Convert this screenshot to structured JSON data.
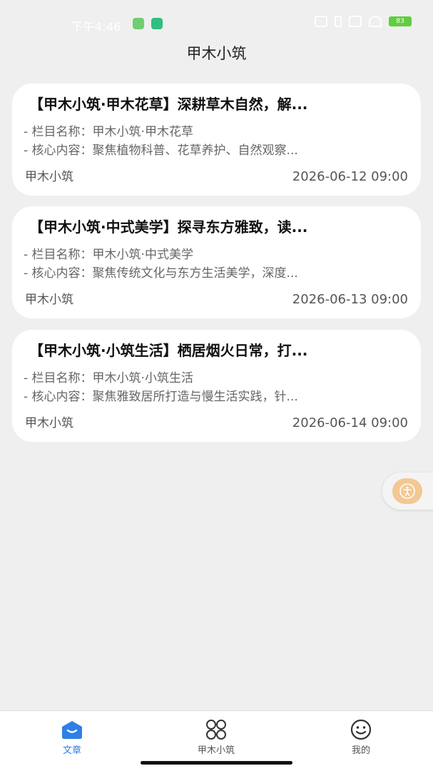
{
  "status_bar": {
    "time": "下午4:46",
    "battery": "83"
  },
  "header": {
    "title": "甲木小筑"
  },
  "articles": [
    {
      "title": "【甲木小筑·甲木花草】深耕草木自然，解...",
      "line1": "- 栏目名称：甲木小筑·甲木花草",
      "line2": "- 核心内容：聚焦植物科普、花草养护、自然观察...",
      "source": "甲木小筑",
      "date": "2026-06-12 09:00"
    },
    {
      "title": "【甲木小筑·中式美学】探寻东方雅致，读...",
      "line1": "- 栏目名称：甲木小筑·中式美学",
      "line2": "- 核心内容：聚焦传统文化与东方生活美学，深度...",
      "source": "甲木小筑",
      "date": "2026-06-13 09:00"
    },
    {
      "title": "【甲木小筑·小筑生活】栖居烟火日常，打...",
      "line1": "- 栏目名称：甲木小筑·小筑生活",
      "line2": "- 核心内容：聚焦雅致居所打造与慢生活实践，针...",
      "source": "甲木小筑",
      "date": "2026-06-14 09:00"
    }
  ],
  "bottom_nav": {
    "items": [
      {
        "label": "文章",
        "icon": "article-home-icon",
        "active": true
      },
      {
        "label": "甲木小筑",
        "icon": "grid-flower-icon",
        "active": false
      },
      {
        "label": "我的",
        "icon": "smiley-profile-icon",
        "active": false
      }
    ]
  },
  "colors": {
    "accent": "#2f7fe6",
    "background": "#efefef",
    "float_button": "#f3c893"
  }
}
